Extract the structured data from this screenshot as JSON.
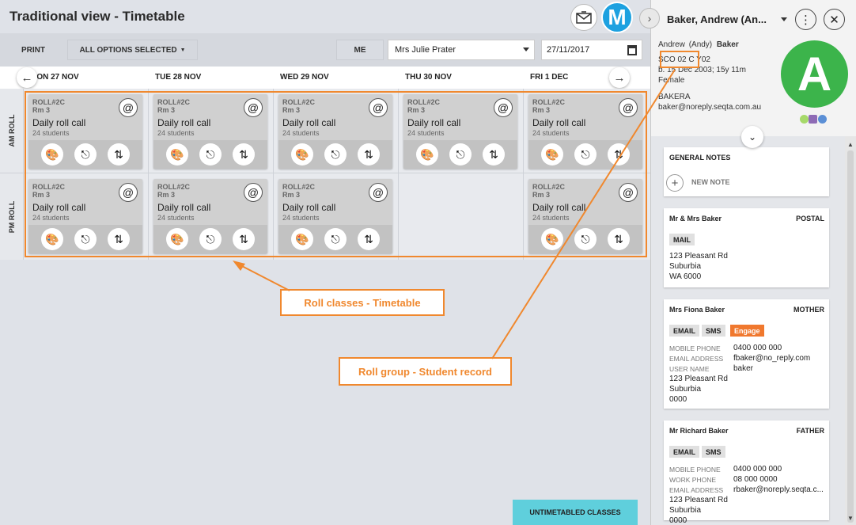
{
  "header": {
    "title": "Traditional view - Timetable",
    "user_initial": "M"
  },
  "toolbar": {
    "print_label": "PRINT",
    "options_label": "ALL OPTIONS SELECTED",
    "me_label": "ME",
    "teacher_value": "Mrs Julie Prater",
    "date_value": "27/11/2017"
  },
  "days": [
    "MON 27 NOV",
    "TUE 28 NOV",
    "WED 29 NOV",
    "THU 30 NOV",
    "FRI 1 DEC"
  ],
  "rows": [
    "AM ROLL",
    "PM ROLL"
  ],
  "class_card": {
    "code": "ROLL#2C",
    "room": "Rm 3",
    "name": "Daily roll call",
    "count": "24 students",
    "at_icon": "@"
  },
  "annotations": {
    "timetable": "Roll classes - Timetable",
    "student_record": "Roll group - Student record"
  },
  "untimetabled_label": "UNTIMETABLED CLASSES",
  "student": {
    "header_name": "Baker, Andrew (An...",
    "first_name": "Andrew",
    "preferred": "(Andy)",
    "surname": "Baker",
    "roll_line": "SCO 02 C Y02",
    "dob_line": "b. 15 Dec 2003; 15y 11m",
    "gender": "Female",
    "username": "BAKERA",
    "email": "baker@noreply.seqta.com.au",
    "avatar_initial": "A",
    "dot_colors": [
      "#a6d96a",
      "#8e6bb5",
      "#5b8fd6"
    ]
  },
  "general_notes": {
    "title": "GENERAL NOTES",
    "new_note_label": "NEW NOTE"
  },
  "contacts": [
    {
      "name": "Mr & Mrs Baker",
      "role": "POSTAL",
      "chips": [
        "MAIL"
      ],
      "address": [
        "123 Pleasant Rd",
        "Suburbia",
        "WA 6000"
      ]
    },
    {
      "name": "Mrs Fiona Baker",
      "role": "MOTHER",
      "chips": [
        "EMAIL",
        "SMS",
        "Engage"
      ],
      "fields": [
        {
          "label": "MOBILE PHONE",
          "value": "0400 000 000"
        },
        {
          "label": "EMAIL ADDRESS",
          "value": "fbaker@no_reply.com"
        },
        {
          "label": "USER NAME",
          "value": "baker"
        }
      ],
      "address": [
        "123 Pleasant Rd",
        "Suburbia",
        "0000"
      ]
    },
    {
      "name": "Mr Richard Baker",
      "role": "FATHER",
      "chips": [
        "EMAIL",
        "SMS"
      ],
      "fields": [
        {
          "label": "MOBILE PHONE",
          "value": "0400 000 000"
        },
        {
          "label": "WORK PHONE",
          "value": "08 000 0000"
        },
        {
          "label": "EMAIL ADDRESS",
          "value": "rbaker@noreply.seqta.c..."
        }
      ],
      "address": [
        "123 Pleasant Rd",
        "Suburbia",
        "0000"
      ]
    }
  ],
  "colors": {
    "accent_orange": "#f0882e",
    "avatar_blue": "#1da1e0",
    "avatar_green": "#3cb44b",
    "untimetabled": "#5fcfdc"
  }
}
